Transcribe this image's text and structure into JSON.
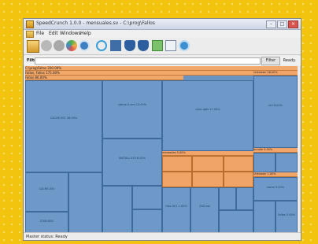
{
  "window": {
    "title": "SpeedCrunch 1.0.0 - mensuales.sv - C:\\prog\\Fallos",
    "buttons": {
      "minimize": "–",
      "maximize": "□",
      "close": "×"
    }
  },
  "menu": {
    "items": [
      "File",
      "Edit",
      "Windows",
      "Help"
    ]
  },
  "toolbar": {
    "icons": [
      "folder-icon",
      "gray-ball-icon",
      "gray-ball-icon",
      "color-circle-icon",
      "gear-ball-icon",
      "refresh-icon",
      "document-icon",
      "shield-icon",
      "shield-icon",
      "chart-icon",
      "bookmark-icon",
      "plus-icon"
    ]
  },
  "filter": {
    "label": "Filter",
    "value": "",
    "button": "Filter",
    "status": "Ready."
  },
  "treemap": {
    "path_rows": [
      "C:\\prog\\Fallos 200.00%",
      "Fallos, Fallos 175.00%",
      "Fallos 86.00%"
    ],
    "right_header": "Unknown 28.00%",
    "tiles": [
      {
        "label": "CACHE.001\n38.00%"
      },
      {
        "label": "status.0.xml\n12.00%"
      },
      {
        "label": "INSTALL.015\n8.00%"
      },
      {
        "label": "alloc.lgds\n17.00%"
      },
      {
        "label": "ctrl\n8.00%"
      },
      {
        "label": "bundle 5.00%"
      },
      {
        "label": "name\n5.00%"
      },
      {
        "label": "Fallos\n5.00%"
      },
      {
        "label": "tiles.001\n1.00%"
      },
      {
        "label": "CACHE.003"
      },
      {
        "label": "ZTAB.REG"
      },
      {
        "label": "ZZZ.idx"
      }
    ],
    "subheaders": [
      "memories 5.00%",
      "Unknown 1.00%"
    ]
  },
  "status": {
    "text": "Master status: Ready"
  }
}
